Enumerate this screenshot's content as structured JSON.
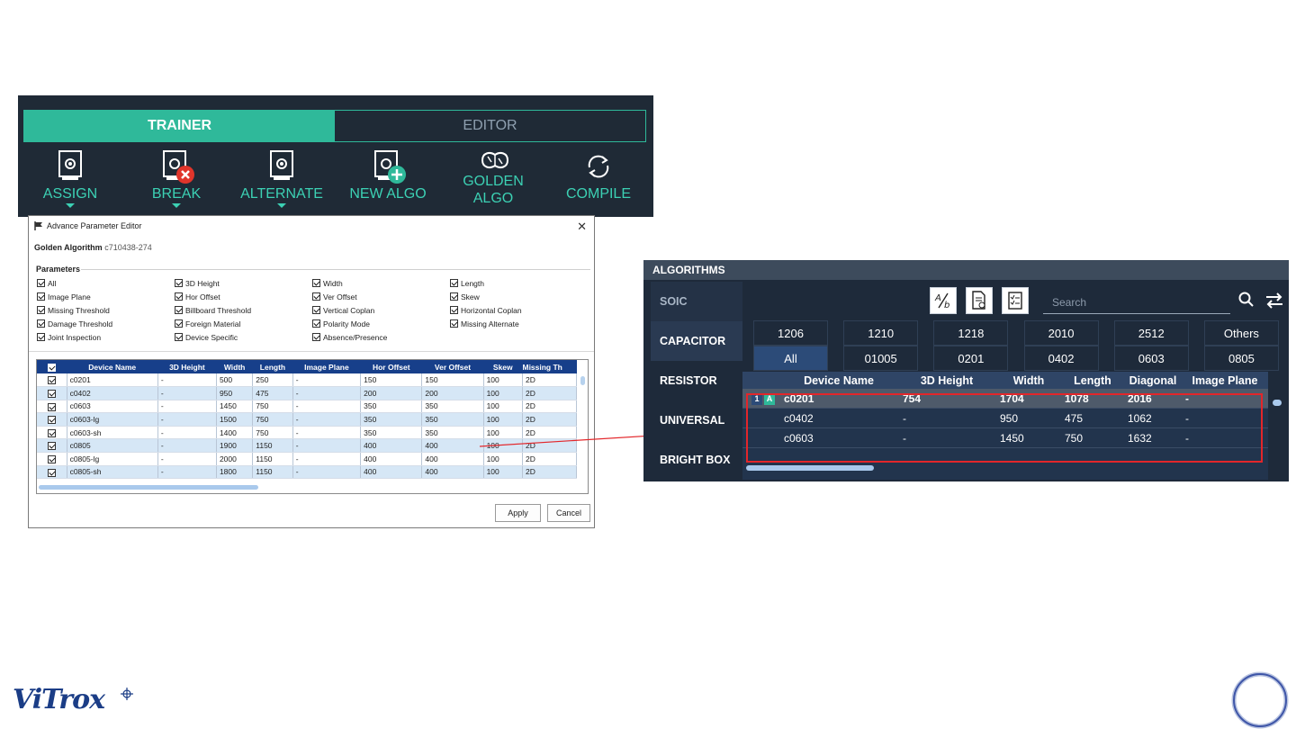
{
  "toolbar": {
    "tabs": [
      "TRAINER",
      "EDITOR"
    ],
    "tools": [
      {
        "label": "ASSIGN",
        "icon": "assign-icon"
      },
      {
        "label": "BREAK",
        "icon": "break-icon"
      },
      {
        "label": "ALTERNATE",
        "icon": "alternate-icon"
      },
      {
        "label": "NEW ALGO",
        "icon": "new-algo-icon"
      },
      {
        "label": "GOLDEN\nALGO",
        "icon": "golden-algo-icon"
      },
      {
        "label": "COMPILE",
        "icon": "compile-icon"
      }
    ],
    "colors": {
      "accent": "#2fb99a",
      "background": "#1f2a36"
    }
  },
  "editor": {
    "title": "Advance Parameter Editor",
    "golden_label": "Golden Algorithm",
    "golden_value": "c710438-274",
    "params_heading": "Parameters",
    "params": [
      "All",
      "3D Height",
      "Width",
      "Length",
      "Image Plane",
      "Hor Offset",
      "Ver Offset",
      "Skew",
      "Missing Threshold",
      "Billboard Threshold",
      "Vertical Coplan",
      "Horizontal Coplan",
      "Damage Threshold",
      "Foreign Material",
      "Polarity Mode",
      "Missing Alternate",
      "Joint Inspection",
      "Device Specific",
      "Absence/Presence"
    ],
    "columns": [
      "Device Name",
      "3D Height",
      "Width",
      "Length",
      "Image Plane",
      "Hor Offset",
      "Ver Offset",
      "Skew",
      "Missing Th"
    ],
    "rows": [
      [
        "c0201",
        "-",
        "500",
        "250",
        "-",
        "150",
        "150",
        "100",
        "2D"
      ],
      [
        "c0402",
        "-",
        "950",
        "475",
        "-",
        "200",
        "200",
        "100",
        "2D"
      ],
      [
        "c0603",
        "-",
        "1450",
        "750",
        "-",
        "350",
        "350",
        "100",
        "2D"
      ],
      [
        "c0603-lg",
        "-",
        "1500",
        "750",
        "-",
        "350",
        "350",
        "100",
        "2D"
      ],
      [
        "c0603-sh",
        "-",
        "1400",
        "750",
        "-",
        "350",
        "350",
        "100",
        "2D"
      ],
      [
        "c0805",
        "-",
        "1900",
        "1150",
        "-",
        "400",
        "400",
        "100",
        "2D"
      ],
      [
        "c0805-lg",
        "-",
        "2000",
        "1150",
        "-",
        "400",
        "400",
        "100",
        "2D"
      ],
      [
        "c0805-sh",
        "-",
        "1800",
        "1150",
        "-",
        "400",
        "400",
        "100",
        "2D"
      ]
    ],
    "apply_label": "Apply",
    "cancel_label": "Cancel"
  },
  "algorithms": {
    "title": "ALGORITHMS",
    "categories": [
      "SOIC",
      "CAPACITOR",
      "RESISTOR",
      "UNIVERSAL",
      "BRIGHT BOX"
    ],
    "search_placeholder": "Search",
    "sizes": [
      "1206",
      "1210",
      "1218",
      "2010",
      "2512",
      "Others",
      "All",
      "01005",
      "0201",
      "0402",
      "0603",
      "0805"
    ],
    "columns": [
      "Device Name",
      "3D Height",
      "Width",
      "Length",
      "Diagonal",
      "Image Plane"
    ],
    "rows": [
      {
        "tag_num": "1",
        "tag_alt": "A",
        "cells": [
          "c0201",
          "754",
          "1704",
          "1078",
          "2016",
          "-"
        ]
      },
      {
        "tag_num": "",
        "tag_alt": "",
        "cells": [
          "c0402",
          "-",
          "950",
          "475",
          "1062",
          "-"
        ]
      },
      {
        "tag_num": "",
        "tag_alt": "",
        "cells": [
          "c0603",
          "-",
          "1450",
          "750",
          "1632",
          "-"
        ]
      }
    ],
    "colors": {
      "highlight": "#e3262a",
      "panel": "#1e2a3a"
    }
  },
  "branding": {
    "logo_text": "ViTrox"
  }
}
